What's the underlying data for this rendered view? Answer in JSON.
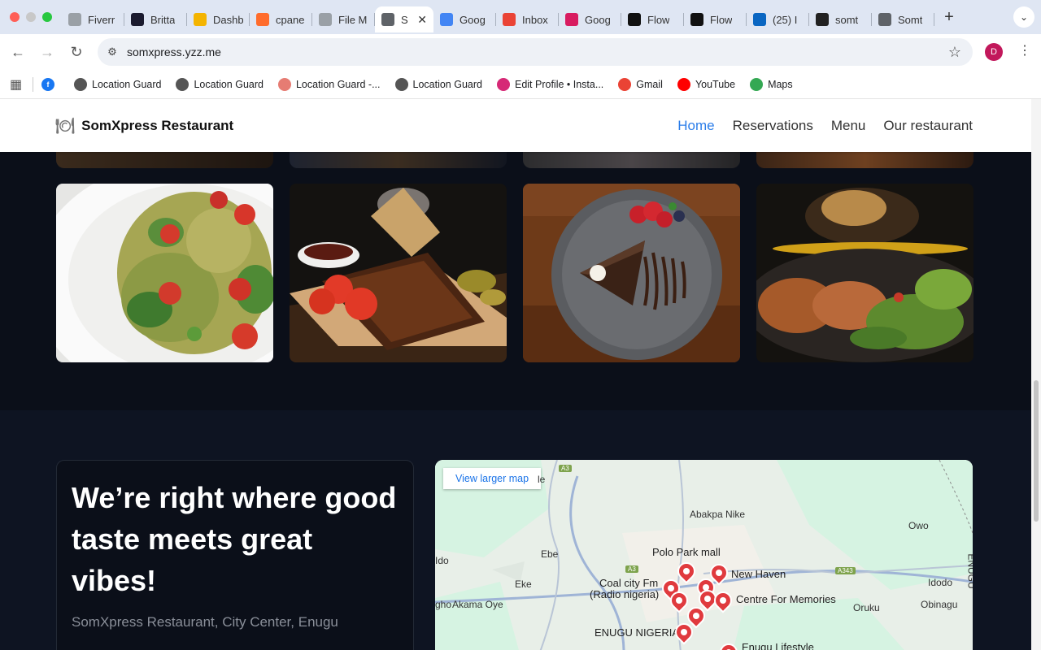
{
  "browser": {
    "tabs": [
      {
        "label": "Fiverr",
        "icon": "globe-icon",
        "color": "#9aa0a6"
      },
      {
        "label": "Britta",
        "icon": "b-icon",
        "color": "#1b1b2f"
      },
      {
        "label": "Dashb",
        "icon": "sparkle-icon",
        "color": "#f4b400"
      },
      {
        "label": "cpane",
        "icon": "cpanel-icon",
        "color": "#ff6c2c"
      },
      {
        "label": "File M",
        "icon": "globe-icon",
        "color": "#9aa0a6"
      },
      {
        "label": "S",
        "icon": "globe-icon",
        "color": "#5f6368",
        "active": true
      },
      {
        "label": "Goog",
        "icon": "gemini-icon",
        "color": "#4285f4"
      },
      {
        "label": "Inbox",
        "icon": "gmail-icon",
        "color": "#ea4335"
      },
      {
        "label": "Goog",
        "icon": "lab-icon",
        "color": "#d81b60"
      },
      {
        "label": "Flow",
        "icon": "flow-icon",
        "color": "#111111"
      },
      {
        "label": "Flow",
        "icon": "flow-icon",
        "color": "#111111"
      },
      {
        "label": "(25) I",
        "icon": "linkedin-icon",
        "color": "#0a66c2"
      },
      {
        "label": "somt",
        "icon": "github-icon",
        "color": "#222222"
      },
      {
        "label": "Somt",
        "icon": "globe-icon",
        "color": "#5f6368"
      }
    ],
    "url": "somxpress.yzz.me",
    "profile_initial": "D",
    "bookmarks": [
      {
        "label": "Location Guard",
        "icon": "globe-icon",
        "color": "#555555"
      },
      {
        "label": "Location Guard",
        "icon": "globe-icon",
        "color": "#555555"
      },
      {
        "label": "Location Guard -...",
        "icon": "rainbow-icon",
        "color": "#e67c73"
      },
      {
        "label": "Location Guard",
        "icon": "globe-icon",
        "color": "#555555"
      },
      {
        "label": "Edit Profile • Insta...",
        "icon": "instagram-icon",
        "color": "#d62976"
      },
      {
        "label": "Gmail",
        "icon": "gmail-icon",
        "color": "#ea4335"
      },
      {
        "label": "YouTube",
        "icon": "youtube-icon",
        "color": "#ff0000"
      },
      {
        "label": "Maps",
        "icon": "maps-icon",
        "color": "#34a853"
      }
    ]
  },
  "site": {
    "brand": "SomXpress Restaurant",
    "nav": [
      "Home",
      "Reservations",
      "Menu",
      "Our restaurant"
    ],
    "active_nav": "Home",
    "accent": "#2b7de9",
    "gallery": [
      {
        "name": "pasta-salad-photo"
      },
      {
        "name": "ribs-board-photo"
      },
      {
        "name": "chocolate-cake-photo"
      },
      {
        "name": "samosa-plate-photo"
      }
    ],
    "headline": "We’re right where good taste meets great vibes!",
    "address": "SomXpress Restaurant, City Center, Enugu",
    "map": {
      "button": "View larger map",
      "labels": [
        "Abakpa Nike",
        "Owo",
        "Polo Park mall",
        "Ebe",
        "New Haven",
        "Coal city Fm",
        "(Radio nigeria)",
        "Eke",
        "Ido",
        "Idodo",
        "Akama Oye",
        "Centre For Memories",
        "Oruku",
        "Obinagu",
        "ENUGU NIGERIA",
        "Enugu Lifestyle",
        "ENUGU"
      ],
      "shields": [
        "A3",
        "A3",
        "A343"
      ]
    }
  }
}
